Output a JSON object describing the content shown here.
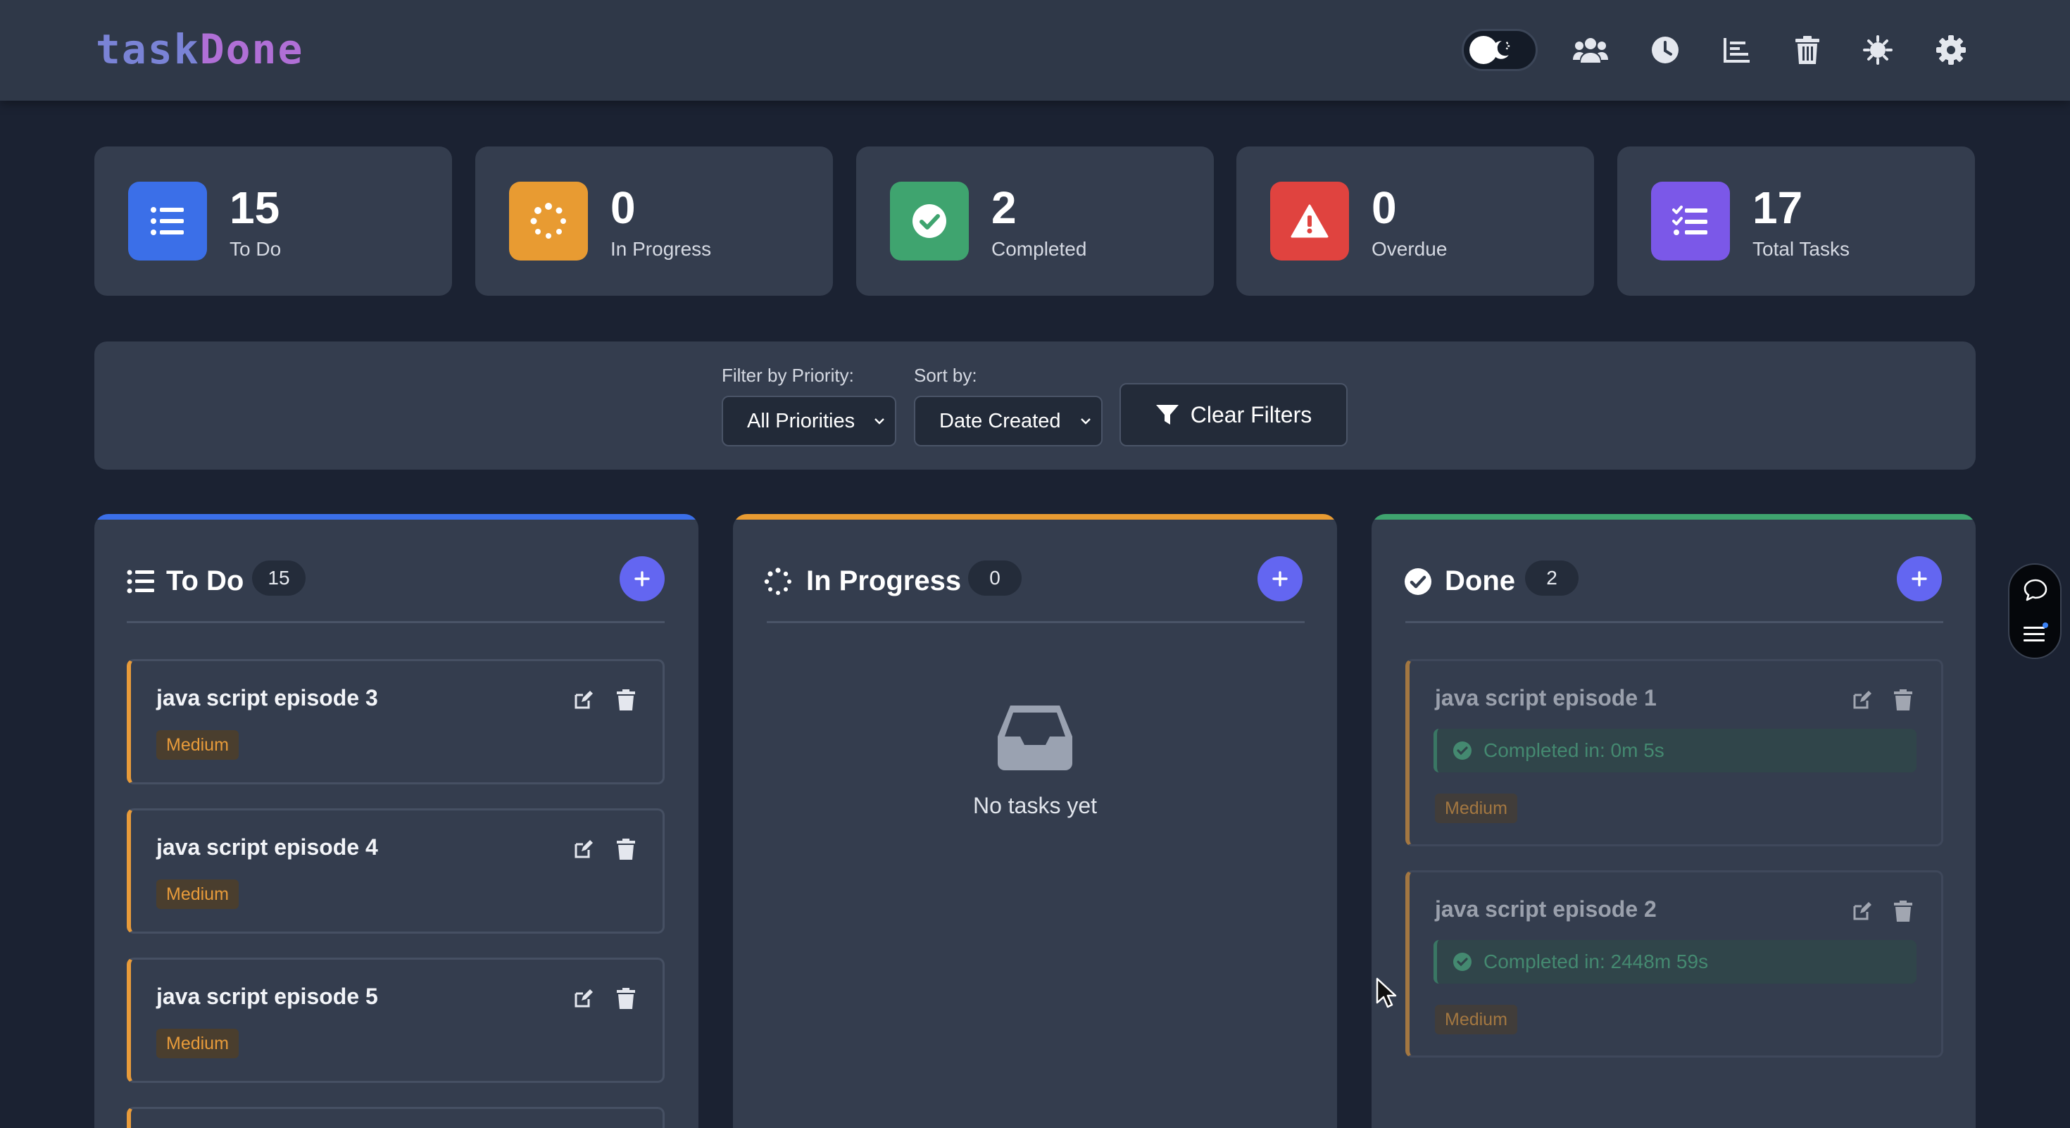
{
  "app": {
    "logo_part1": "task",
    "logo_part2": "Done"
  },
  "header_icons": [
    "theme-toggle",
    "users-icon",
    "history-icon",
    "chart-icon",
    "trash-icon",
    "bug-icon",
    "settings-icon"
  ],
  "stats": [
    {
      "value": "15",
      "label": "To Do",
      "color": "#3b6fe8",
      "icon": "list-icon"
    },
    {
      "value": "0",
      "label": "In Progress",
      "color": "#e89b32",
      "icon": "spinner-icon"
    },
    {
      "value": "2",
      "label": "Completed",
      "color": "#3fa46f",
      "icon": "check-circle-icon"
    },
    {
      "value": "0",
      "label": "Overdue",
      "color": "#e0433f",
      "icon": "warning-icon"
    },
    {
      "value": "17",
      "label": "Total Tasks",
      "color": "#7b58e8",
      "icon": "tasks-icon"
    }
  ],
  "filters": {
    "priority_label": "Filter by Priority:",
    "priority_value": "All Priorities",
    "sort_label": "Sort by:",
    "sort_value": "Date Created",
    "clear_label": "Clear Filters"
  },
  "columns": {
    "todo": {
      "title": "To Do",
      "count": "15",
      "accent": "#3b6fe8",
      "tasks": [
        {
          "name": "java script episode 3",
          "priority": "Medium"
        },
        {
          "name": "java script episode 4",
          "priority": "Medium"
        },
        {
          "name": "java script episode 5",
          "priority": "Medium"
        }
      ]
    },
    "progress": {
      "title": "In Progress",
      "count": "0",
      "accent": "#e89b32",
      "empty_text": "No tasks yet"
    },
    "done": {
      "title": "Done",
      "count": "2",
      "accent": "#3fa46f",
      "tasks": [
        {
          "name": "java script episode 1",
          "completed": "Completed in: 0m 5s",
          "priority": "Medium"
        },
        {
          "name": "java script episode 2",
          "completed": "Completed in: 2448m 59s",
          "priority": "Medium"
        }
      ]
    }
  }
}
